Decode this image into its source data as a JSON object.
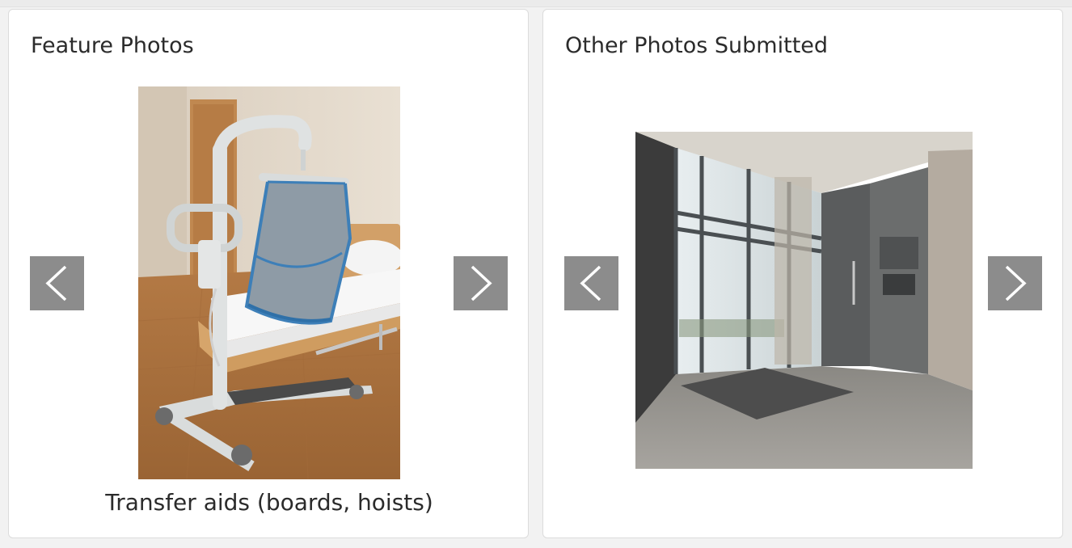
{
  "feature_panel": {
    "title": "Feature Photos",
    "caption": "Transfer aids (boards, hoists)",
    "image_subject": "patient-hoist-with-sling-beside-hospital-bed",
    "prev_icon": "chevron-left-icon",
    "next_icon": "chevron-right-icon"
  },
  "other_panel": {
    "title": "Other Photos Submitted",
    "image_subject": "building-entrance-lobby-with-glass-doors",
    "prev_icon": "chevron-left-icon",
    "next_icon": "chevron-right-icon"
  },
  "colors": {
    "nav_button_bg": "#8c8c8c",
    "nav_chevron": "#ffffff",
    "card_border": "#dcdcdc",
    "text": "#2b2b2b"
  }
}
